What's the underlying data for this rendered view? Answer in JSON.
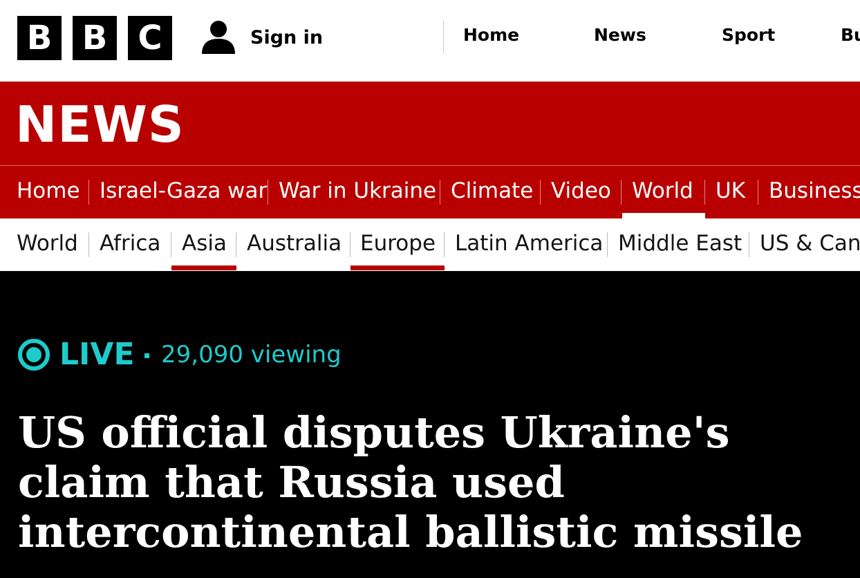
{
  "bbc_logo": {
    "letters": [
      "B",
      "B",
      "C"
    ]
  },
  "top_nav": {
    "sign_in": "Sign in",
    "sign_in_icon": "person-icon",
    "items": [
      "Home",
      "News",
      "Sport",
      "Bu"
    ]
  },
  "news_logo": "NEWS",
  "primary_nav": {
    "items": [
      "Home",
      "Israel-Gaza war",
      "War in Ukraine",
      "Climate",
      "Video",
      "World",
      "UK",
      "Business"
    ],
    "active": "World"
  },
  "secondary_nav": {
    "items": [
      "World",
      "Africa",
      "Asia",
      "Australia",
      "Europe",
      "Latin America",
      "Middle East",
      "US & Cana"
    ],
    "highlighted": [
      "Asia",
      "Europe"
    ]
  },
  "live": {
    "label": "LIVE",
    "icon": "live-indicator-icon",
    "separator": "·",
    "viewing": "29,090 viewing"
  },
  "headline": "US official disputes Ukraine's claim that Russia used intercontinental ballistic missile",
  "colors": {
    "bbc_red": "#b80000",
    "live_teal": "#1ecbcb",
    "background": "#000000",
    "text_white": "#ffffff"
  }
}
